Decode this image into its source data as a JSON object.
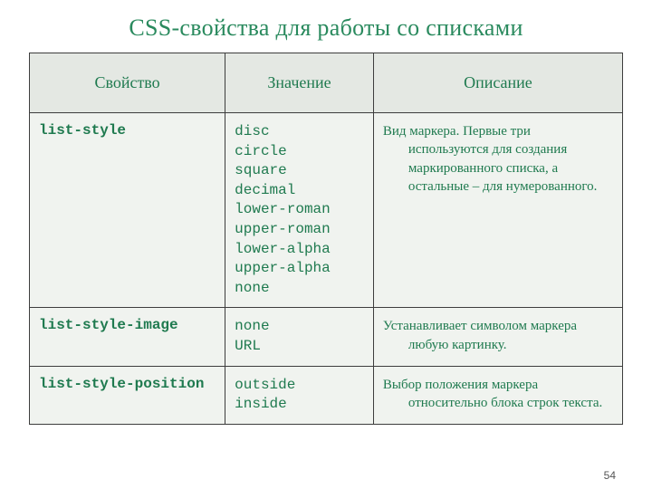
{
  "title": "CSS-свойства для работы со списками",
  "headers": {
    "property": "Свойство",
    "value": "Значение",
    "description": "Описание"
  },
  "rows": [
    {
      "property": "list-style",
      "values": "disc\ncircle\nsquare\ndecimal\nlower-roman\nupper-roman\nlower-alpha\nupper-alpha\nnone",
      "description": "Вид маркера. Первые три используются для создания маркированного списка, а остальные – для нумерованного."
    },
    {
      "property": "list-style-image",
      "values": "none\nURL",
      "description": "\nУстанавливает символом маркера любую картинку."
    },
    {
      "property": "list-style-position",
      "values": "outside\ninside",
      "description": "Выбор положения маркера относительно блока строк текста."
    }
  ],
  "page_number": "54"
}
